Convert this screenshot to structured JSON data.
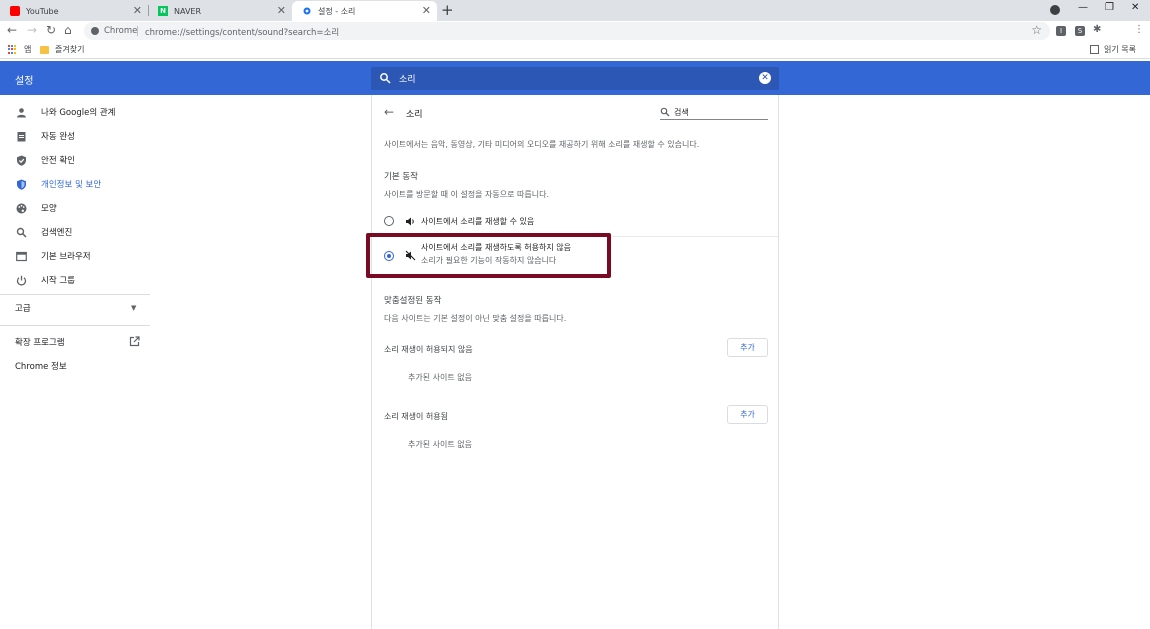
{
  "browser": {
    "tabs": [
      {
        "title": "YouTube",
        "favicon_color": "#ff0000"
      },
      {
        "title": "NAVER",
        "favicon_color": "#03c75a"
      },
      {
        "title": "설정 - 소리",
        "favicon_color": "#1a73e8"
      }
    ],
    "omnibox": {
      "chip": "Chrome",
      "url": "chrome://settings/content/sound?search=소리"
    },
    "bookmarks": [
      {
        "label": "앱",
        "icon": "apps-grid-icon"
      },
      {
        "label": "즐겨찾기",
        "icon": "folder-icon"
      }
    ],
    "reading_list": "읽기 목록",
    "extensions": [
      "I",
      "S"
    ]
  },
  "settings": {
    "title": "설정",
    "search_value": "소리",
    "sidebar": {
      "items": [
        {
          "label": "나와 Google의 관계",
          "icon": "person-icon"
        },
        {
          "label": "자동 완성",
          "icon": "clipboard-icon"
        },
        {
          "label": "안전 확인",
          "icon": "shield-check-icon"
        },
        {
          "label": "개인정보 및 보안",
          "icon": "shield-icon",
          "active": true
        },
        {
          "label": "모양",
          "icon": "palette-icon"
        },
        {
          "label": "검색엔진",
          "icon": "search-icon"
        },
        {
          "label": "기본 브라우저",
          "icon": "browser-icon"
        },
        {
          "label": "시작 그룹",
          "icon": "power-icon"
        }
      ],
      "advanced": "고급",
      "extensions": "확장 프로그램",
      "about": "Chrome 정보"
    },
    "page": {
      "title": "소리",
      "search_placeholder": "검색",
      "description": "사이트에서는 음악, 동영상, 기타 미디어의 오디오를 재공하기 위해 소리를 재생할 수 있습니다.",
      "default_heading": "기본 동작",
      "default_desc": "사이트를 방문할 때 이 설정을 자동으로 따릅니다.",
      "option_allow": "사이트에서 소리를 재생할 수 있음",
      "option_block": "사이트에서 소리를 재생하도록 허용하지 않음",
      "option_block_sub": "소리가 필요한 기능이 작동하지 않습니다",
      "custom_heading": "맞춤설정된 동작",
      "custom_desc": "다음 사이트는 기본 설정이 아닌 맞춤 설정을 따릅니다.",
      "not_allowed_label": "소리 재생이 허용되지 않음",
      "allowed_label": "소리 재생이 허용됨",
      "add_label": "추가",
      "empty_label": "추가된 사이트 없음"
    },
    "accent_color": "#3367d6",
    "highlight_color": "#7a0a24"
  }
}
